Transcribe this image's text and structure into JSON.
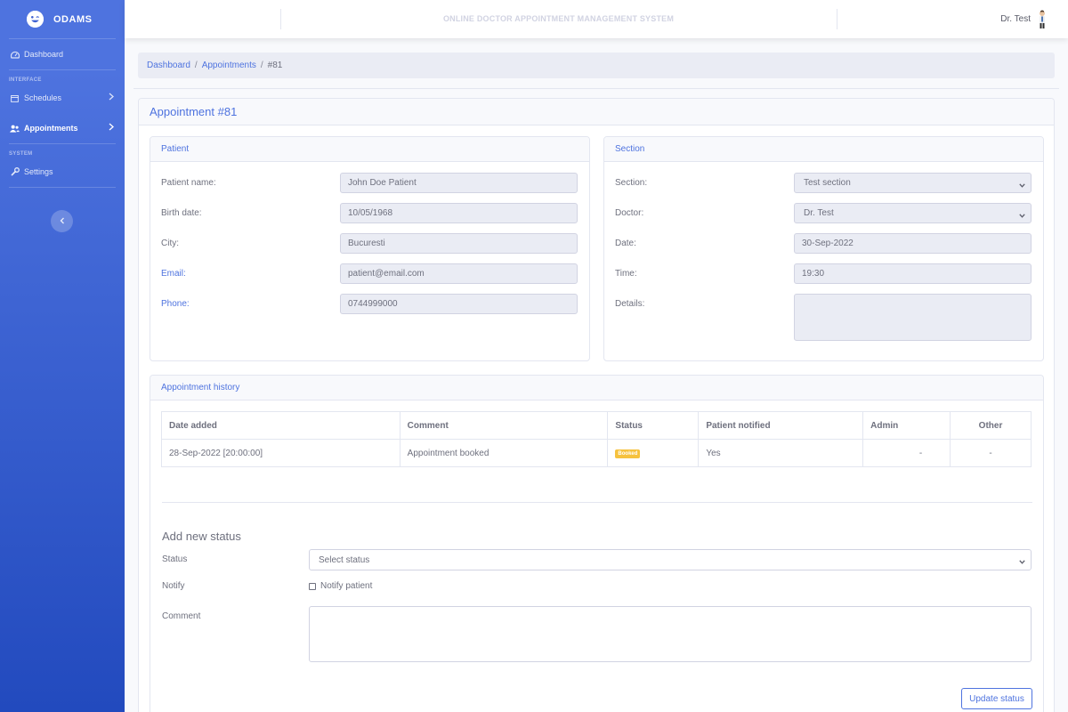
{
  "sidebar": {
    "brand": "ODAMS",
    "dashboard": "Dashboard",
    "heading_interface": "INTERFACE",
    "schedules": "Schedules",
    "appointments": "Appointments",
    "heading_system": "SYSTEM",
    "settings": "Settings"
  },
  "topbar": {
    "title": "ONLINE DOCTOR APPOINTMENT MANAGEMENT SYSTEM",
    "user": "Dr. Test"
  },
  "breadcrumb": {
    "dashboard": "Dashboard",
    "appointments": "Appointments",
    "current": "#81"
  },
  "page": {
    "title": "Appointment #81"
  },
  "patient": {
    "header": "Patient",
    "name_label": "Patient name:",
    "name": "John Doe Patient",
    "birth_label": "Birth date:",
    "birth": "10/05/1968",
    "city_label": "City:",
    "city": "Bucuresti",
    "email_label": "Email:",
    "email": "patient@email.com",
    "phone_label": "Phone:",
    "phone": "0744999000"
  },
  "section": {
    "header": "Section",
    "section_label": "Section:",
    "section": "Test section",
    "doctor_label": "Doctor:",
    "doctor": "Dr. Test",
    "date_label": "Date:",
    "date": "30-Sep-2022",
    "time_label": "Time:",
    "time": "19:30",
    "details_label": "Details:"
  },
  "history": {
    "header": "Appointment history",
    "columns": [
      "Date added",
      "Comment",
      "Status",
      "Patient notified",
      "Admin",
      "Other"
    ],
    "rows": [
      {
        "date": "28-Sep-2022 [20:00:00]",
        "comment": "Appointment booked",
        "status": "Booked",
        "notified": "Yes",
        "admin": "-",
        "other": "-"
      }
    ]
  },
  "add_status": {
    "title": "Add new status",
    "status_label": "Status",
    "status_placeholder": "Select status",
    "notify_label": "Notify",
    "notify_checkbox": "Notify patient",
    "comment_label": "Comment",
    "submit": "Update status"
  },
  "colors": {
    "primary": "#4e73df",
    "warning": "#f6c23e",
    "sidebar_bottom": "#224abe"
  }
}
